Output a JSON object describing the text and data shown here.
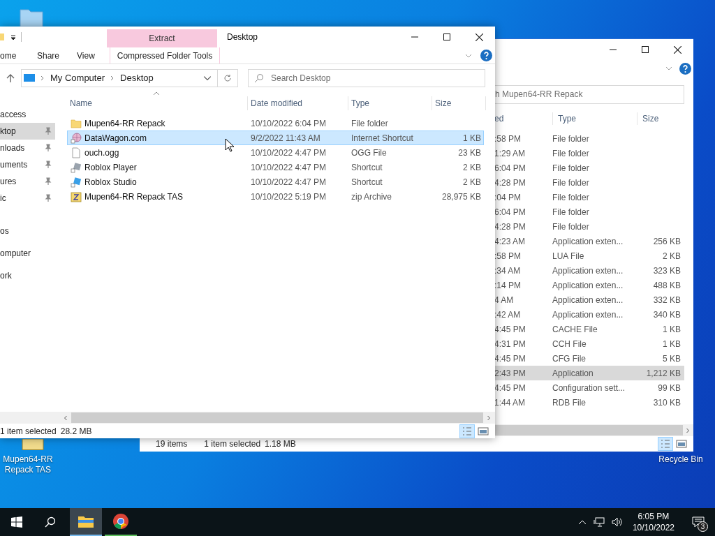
{
  "desktop": {
    "icons": [
      {
        "label": "Mupen64-RR Repack TAS",
        "kind": "zip"
      },
      {
        "label": "Recycle Bin",
        "kind": "bin"
      }
    ]
  },
  "back_window": {
    "search_placeholder": "h Mupen64-RR Repack",
    "columns": [
      "ed",
      "Type",
      "Size"
    ],
    "rows": [
      {
        "date": ":58 PM",
        "type": "File folder",
        "size": "",
        "selected": false
      },
      {
        "date": "1:29 AM",
        "type": "File folder",
        "size": "",
        "selected": false
      },
      {
        "date": "6:04 PM",
        "type": "File folder",
        "size": "",
        "selected": false
      },
      {
        "date": "4:28 PM",
        "type": "File folder",
        "size": "",
        "selected": false
      },
      {
        "date": ":04 PM",
        "type": "File folder",
        "size": "",
        "selected": false
      },
      {
        "date": "6:04 PM",
        "type": "File folder",
        "size": "",
        "selected": false
      },
      {
        "date": "4:28 PM",
        "type": "File folder",
        "size": "",
        "selected": false
      },
      {
        "date": "4:23 AM",
        "type": "Application exten...",
        "size": "256 KB",
        "selected": false
      },
      {
        "date": ":58 PM",
        "type": "LUA File",
        "size": "2 KB",
        "selected": false
      },
      {
        "date": ":34 AM",
        "type": "Application exten...",
        "size": "323 KB",
        "selected": false
      },
      {
        "date": ":14 PM",
        "type": "Application exten...",
        "size": "488 KB",
        "selected": false
      },
      {
        "date": "4 AM",
        "type": "Application exten...",
        "size": "332 KB",
        "selected": false
      },
      {
        "date": ":42 AM",
        "type": "Application exten...",
        "size": "340 KB",
        "selected": false
      },
      {
        "date": "4:45 PM",
        "type": "CACHE File",
        "size": "1 KB",
        "selected": false
      },
      {
        "date": "4:31 PM",
        "type": "CCH File",
        "size": "1 KB",
        "selected": false
      },
      {
        "date": "4:45 PM",
        "type": "CFG File",
        "size": "5 KB",
        "selected": false
      },
      {
        "date": "2:43 PM",
        "type": "Application",
        "size": "1,212 KB",
        "selected": true
      },
      {
        "date": "4:45 PM",
        "type": "Configuration sett...",
        "size": "99 KB",
        "selected": false
      },
      {
        "date": "1:44 AM",
        "type": "RDB File",
        "size": "310 KB",
        "selected": false
      }
    ],
    "status": [
      "19 items",
      "1 item selected",
      "1.18 MB"
    ]
  },
  "front_window": {
    "title": "Desktop",
    "context_tab": "Extract",
    "context_group": "Compressed Folder Tools",
    "ribbon_tabs": [
      "ome",
      "Share",
      "View"
    ],
    "address": [
      "My Computer",
      "Desktop"
    ],
    "search_placeholder": "Search Desktop",
    "nav": [
      {
        "label": "access",
        "pinned": false,
        "selected": false
      },
      {
        "label": "ktop",
        "pinned": true,
        "selected": true
      },
      {
        "label": "nloads",
        "pinned": true,
        "selected": false
      },
      {
        "label": "uments",
        "pinned": true,
        "selected": false
      },
      {
        "label": "ures",
        "pinned": true,
        "selected": false
      },
      {
        "label": "ic",
        "pinned": true,
        "selected": false
      },
      {
        "label": "os",
        "pinned": false,
        "selected": false
      },
      {
        "label": "omputer",
        "pinned": false,
        "selected": false
      },
      {
        "label": "ork",
        "pinned": false,
        "selected": false
      }
    ],
    "columns": [
      "Name",
      "Date modified",
      "Type",
      "Size"
    ],
    "rows": [
      {
        "kind": "folder",
        "name": "Mupen64-RR Repack",
        "date": "10/10/2022 6:04 PM",
        "type": "File folder",
        "size": "",
        "selected": false
      },
      {
        "kind": "web",
        "name": "DataWagon.com",
        "date": "9/2/2022 11:43 AM",
        "type": "Internet Shortcut",
        "size": "1 KB",
        "selected": true
      },
      {
        "kind": "file",
        "name": "ouch.ogg",
        "date": "10/10/2022 4:47 PM",
        "type": "OGG File",
        "size": "23 KB",
        "selected": false
      },
      {
        "kind": "shortcut",
        "name": "Roblox Player",
        "date": "10/10/2022 4:47 PM",
        "type": "Shortcut",
        "size": "2 KB",
        "selected": false
      },
      {
        "kind": "studio",
        "name": "Roblox Studio",
        "date": "10/10/2022 4:47 PM",
        "type": "Shortcut",
        "size": "2 KB",
        "selected": false
      },
      {
        "kind": "zip",
        "name": "Mupen64-RR Repack TAS",
        "date": "10/10/2022 5:19 PM",
        "type": "zip Archive",
        "size": "28,975 KB",
        "selected": false
      }
    ],
    "status": [
      "1 item selected",
      "28.2 MB"
    ]
  },
  "taskbar": {
    "apps": [
      {
        "kind": "explorer",
        "active": true
      },
      {
        "kind": "chrome",
        "active": false
      }
    ],
    "time": "6:05 PM",
    "date": "10/10/2022",
    "notifications": "3"
  }
}
